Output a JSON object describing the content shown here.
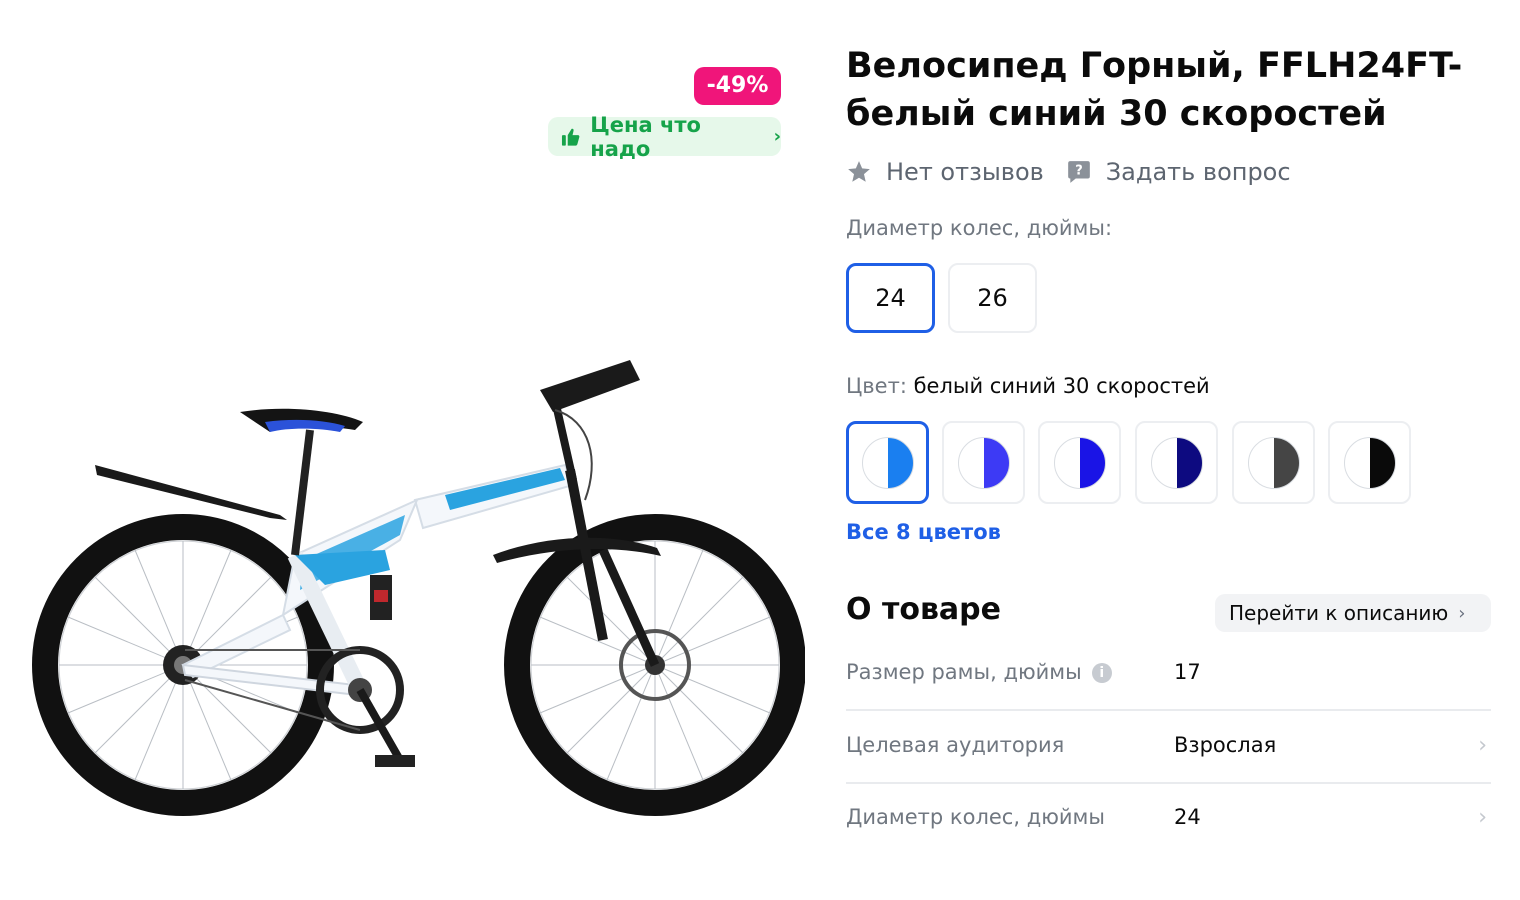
{
  "badges": {
    "discount": "-49%",
    "price_tag": "Цена что надо"
  },
  "product": {
    "title": "Велосипед Горный, FFLH24FT-белый синий 30 скоростей",
    "reviews": "Нет отзывов",
    "ask_question": "Задать вопрос"
  },
  "wheel_size": {
    "label": "Диаметр колес, дюймы:",
    "options": [
      "24",
      "26"
    ],
    "selected": "24"
  },
  "color": {
    "label": "Цвет:",
    "value": "белый синий 30 скоростей",
    "swatches": [
      "#1a7ff0",
      "#3d3af5",
      "#1a14e6",
      "#0d0a80",
      "#454545",
      "#0a0a0a"
    ],
    "all_colors": "Все 8 цветов"
  },
  "about": {
    "title": "О товаре",
    "goto": "Перейти к описанию",
    "specs": [
      {
        "key": "Размер рамы, дюймы",
        "value": "17"
      },
      {
        "key": "Целевая аудитория",
        "value": "Взрослая"
      },
      {
        "key": "Диаметр колес, дюймы",
        "value": "24"
      }
    ]
  },
  "colors": {
    "accent": "#1f5fe6",
    "discount": "#f0157a",
    "green": "#16a34a"
  }
}
